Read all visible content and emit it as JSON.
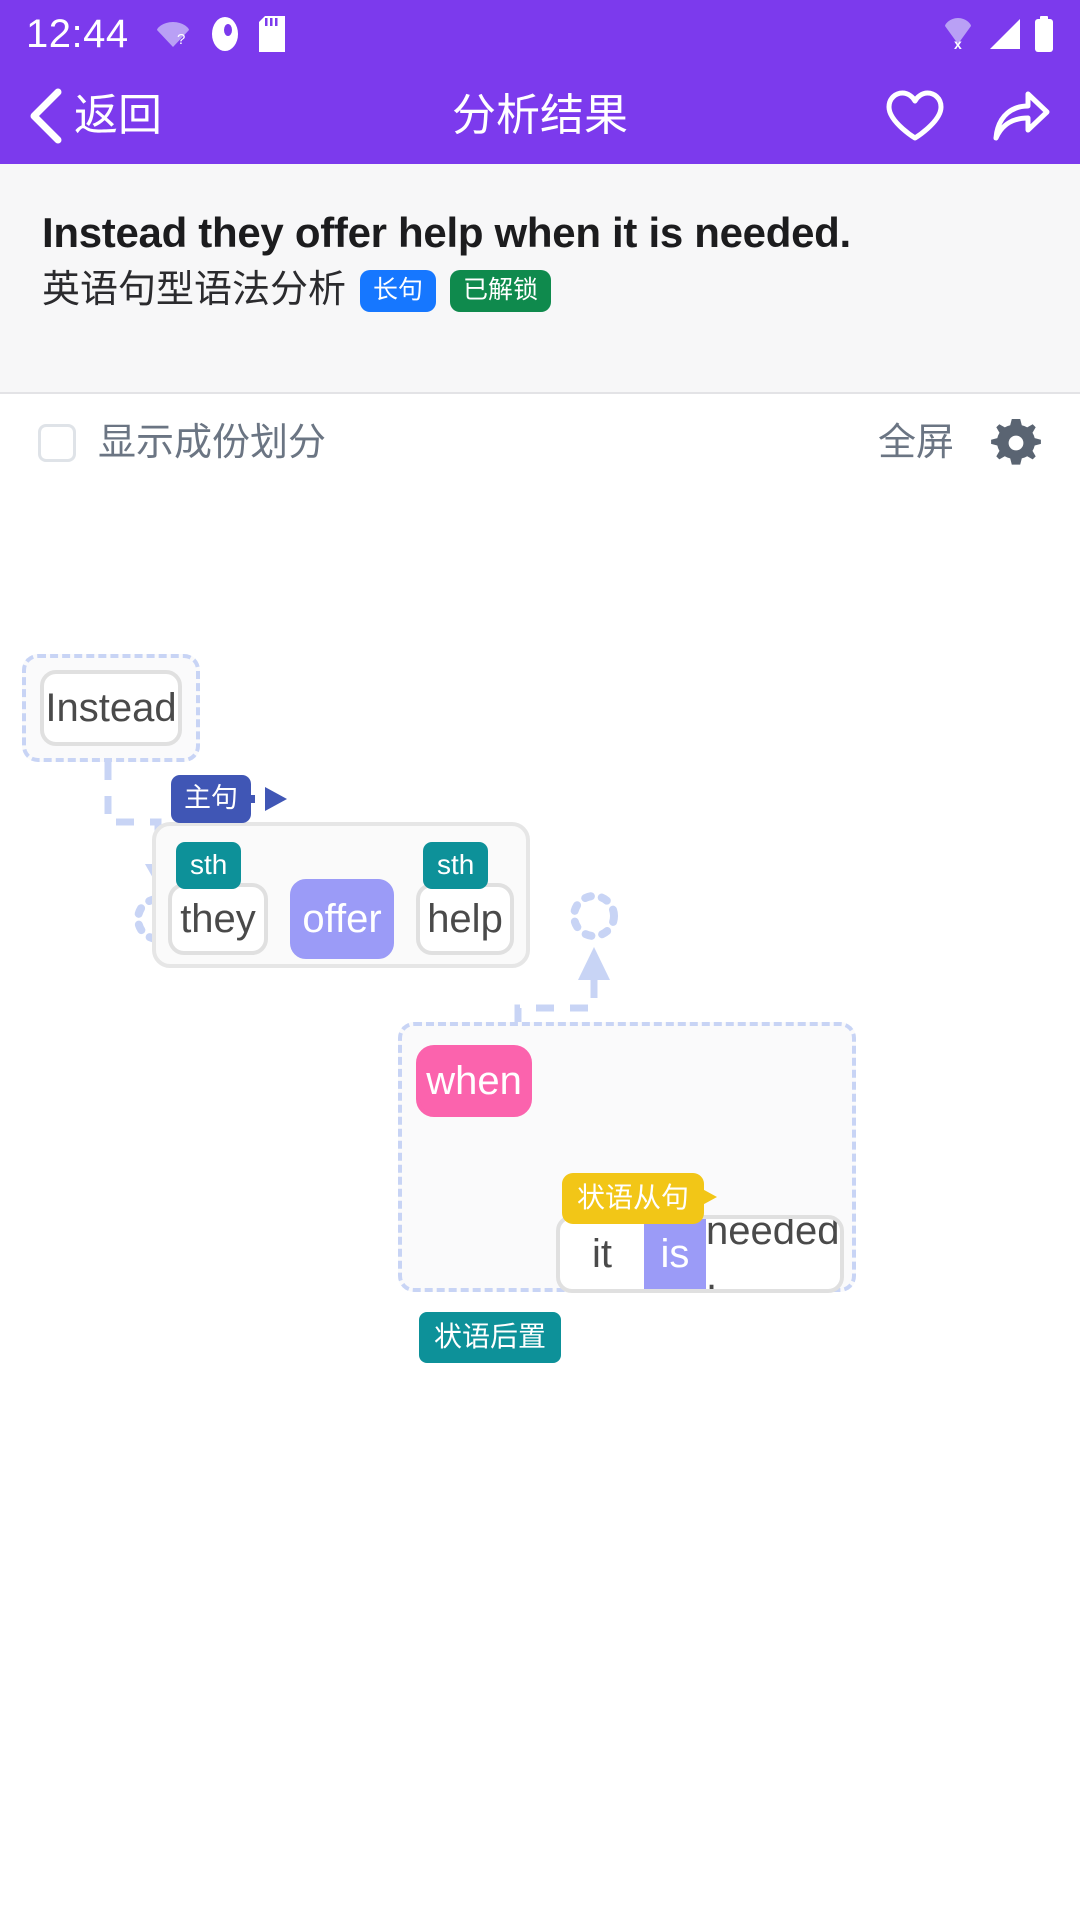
{
  "status_bar": {
    "time": "12:44",
    "icons": [
      "wifi-question-icon",
      "app-notification-icon",
      "sd-card-icon"
    ],
    "right_icons": [
      "wifi-off-icon",
      "signal-bars-icon",
      "battery-full-icon"
    ]
  },
  "app_bar": {
    "back_label": "返回",
    "title": "分析结果",
    "favorite_icon": "heart-icon",
    "share_icon": "share-arrow-icon"
  },
  "sentence_header": {
    "sentence": "Instead they offer help when it is needed.",
    "subtitle": "英语句型语法分析",
    "tags": [
      {
        "label": "长句",
        "color": "#1677ff"
      },
      {
        "label": "已解锁",
        "color": "#0f8a4d"
      }
    ]
  },
  "options_bar": {
    "checkbox_label": "显示成份划分",
    "checkbox_checked": false,
    "fullscreen_label": "全屏",
    "settings_icon": "gear-icon"
  },
  "diagram": {
    "nodes": {
      "instead": "Instead",
      "they": "they",
      "offer": "offer",
      "help": "help",
      "when": "when",
      "it": "it",
      "is": "is",
      "needed": "needed ."
    },
    "minitags": {
      "subject_sth": "sth",
      "object_sth": "sth"
    },
    "badges": {
      "main_clause": "主句",
      "adverbial_clause": "状语从句",
      "adverbial_postposed": "状语后置"
    },
    "colors": {
      "verb": "#9b9bf7",
      "conjunction": "#fb63ad",
      "sth_tag": "#0d9199",
      "main_clause_badge": "#4056b5",
      "adverbial_clause_badge": "#f2c617",
      "adverbial_postposed_badge": "#0d9199",
      "dashed_link": "#c8d4f5",
      "accent": "#7c3aed"
    }
  }
}
